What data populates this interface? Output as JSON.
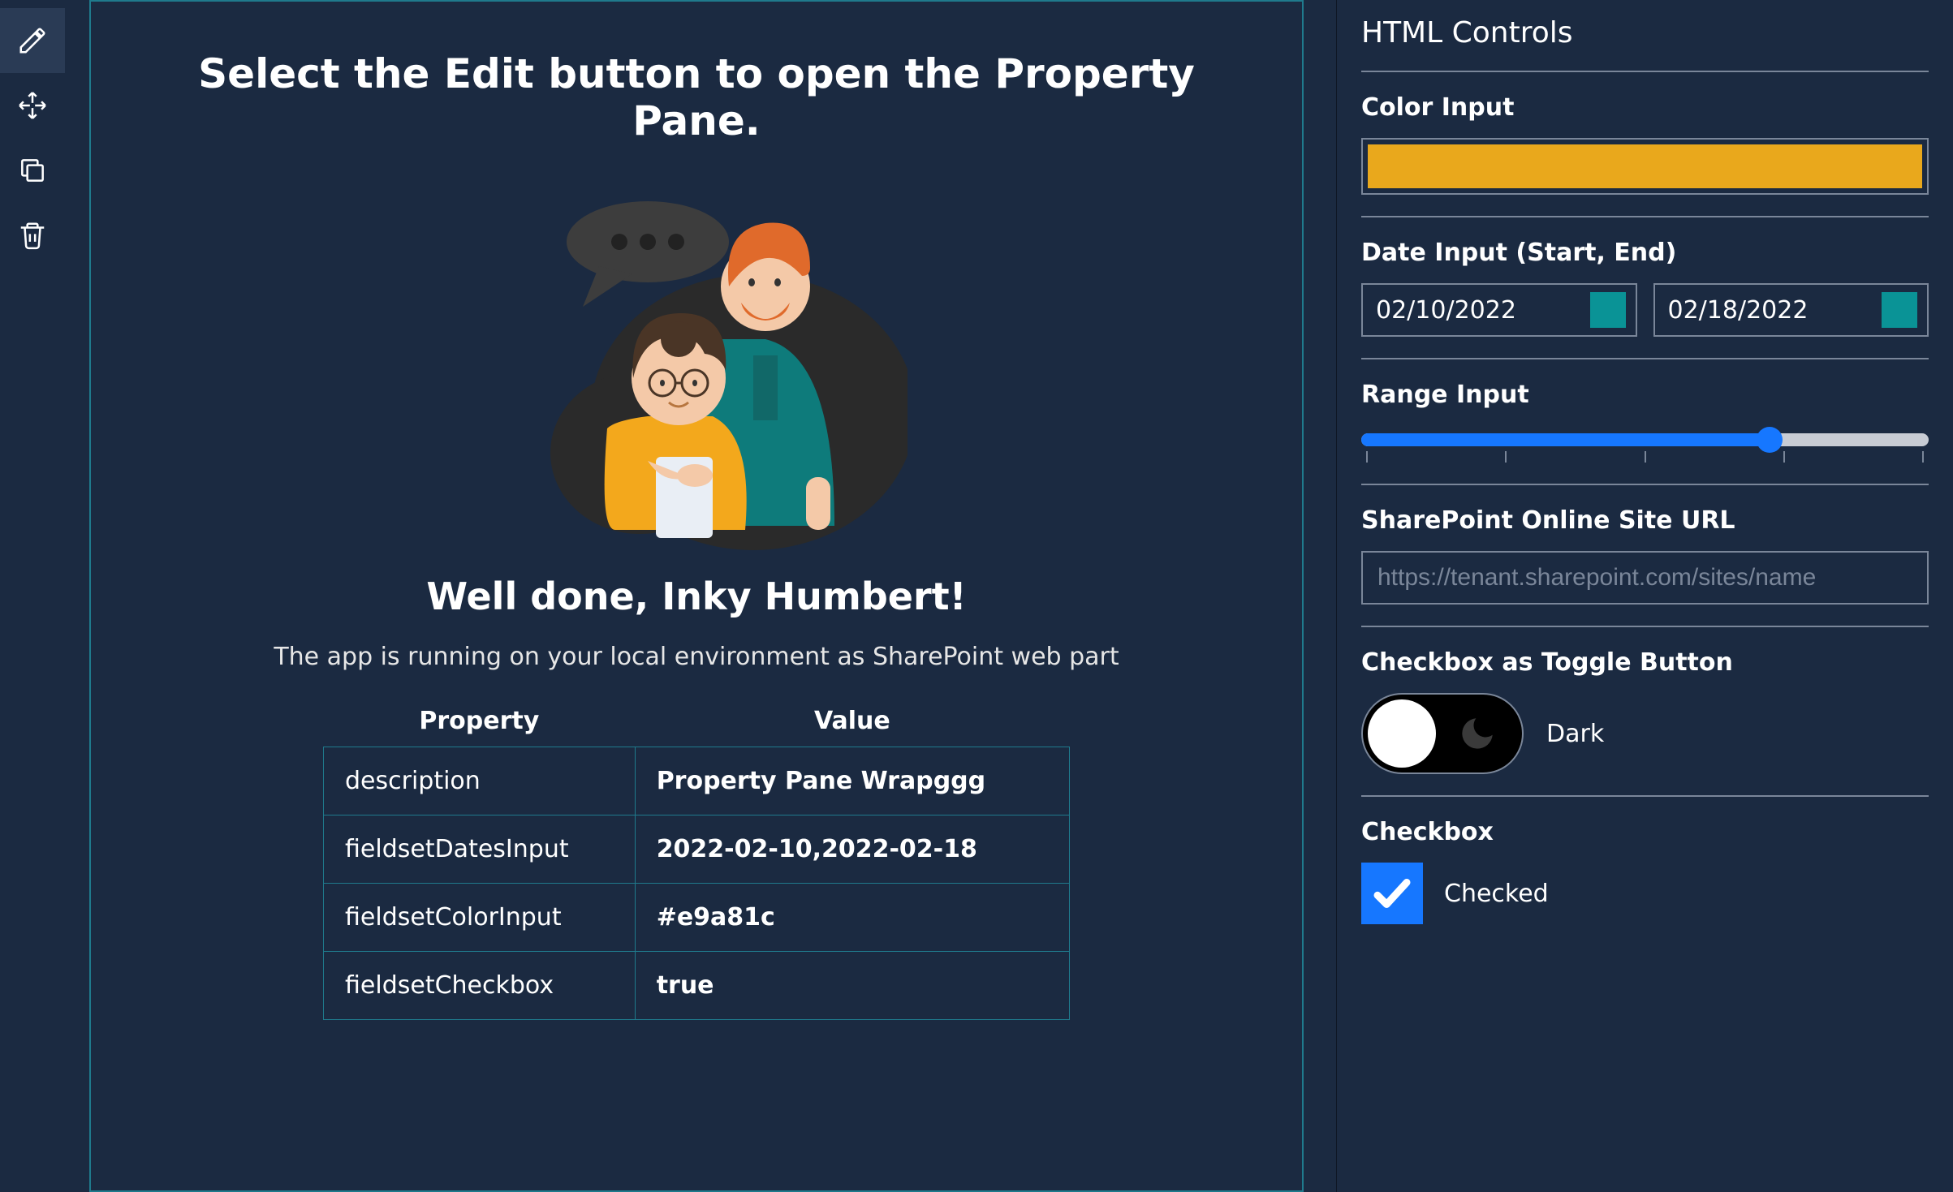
{
  "toolbar": {
    "items": [
      {
        "name": "edit",
        "active": true
      },
      {
        "name": "move",
        "active": false
      },
      {
        "name": "duplicate",
        "active": false
      },
      {
        "name": "delete",
        "active": false
      }
    ]
  },
  "webpart": {
    "title": "Select the Edit button to open the Property Pane.",
    "greeting": "Well done, Inky Humbert!",
    "description": "The app is running on your local environment as SharePoint web part",
    "table": {
      "headers": [
        "Property",
        "Value"
      ],
      "rows": [
        {
          "property": "description",
          "value": "Property Pane Wrapggg"
        },
        {
          "property": "fieldsetDatesInput",
          "value": "2022-02-10,2022-02-18"
        },
        {
          "property": "fieldsetColorInput",
          "value": "#e9a81c"
        },
        {
          "property": "fieldsetCheckbox",
          "value": "true"
        }
      ]
    }
  },
  "pane": {
    "title": "HTML Controls",
    "color": {
      "label": "Color Input",
      "value": "#e9a81c"
    },
    "dates": {
      "label": "Date Input (Start, End)",
      "start": "02/10/2022",
      "end": "02/18/2022"
    },
    "range": {
      "label": "Range Input",
      "percent": 72
    },
    "siteUrl": {
      "label": "SharePoint Online Site URL",
      "placeholder": "https://tenant.sharepoint.com/sites/name",
      "value": ""
    },
    "toggle": {
      "label": "Checkbox as Toggle Button",
      "optionLabel": "Dark",
      "checked": false
    },
    "checkbox": {
      "label": "Checkbox",
      "optionLabel": "Checked",
      "checked": true
    }
  }
}
